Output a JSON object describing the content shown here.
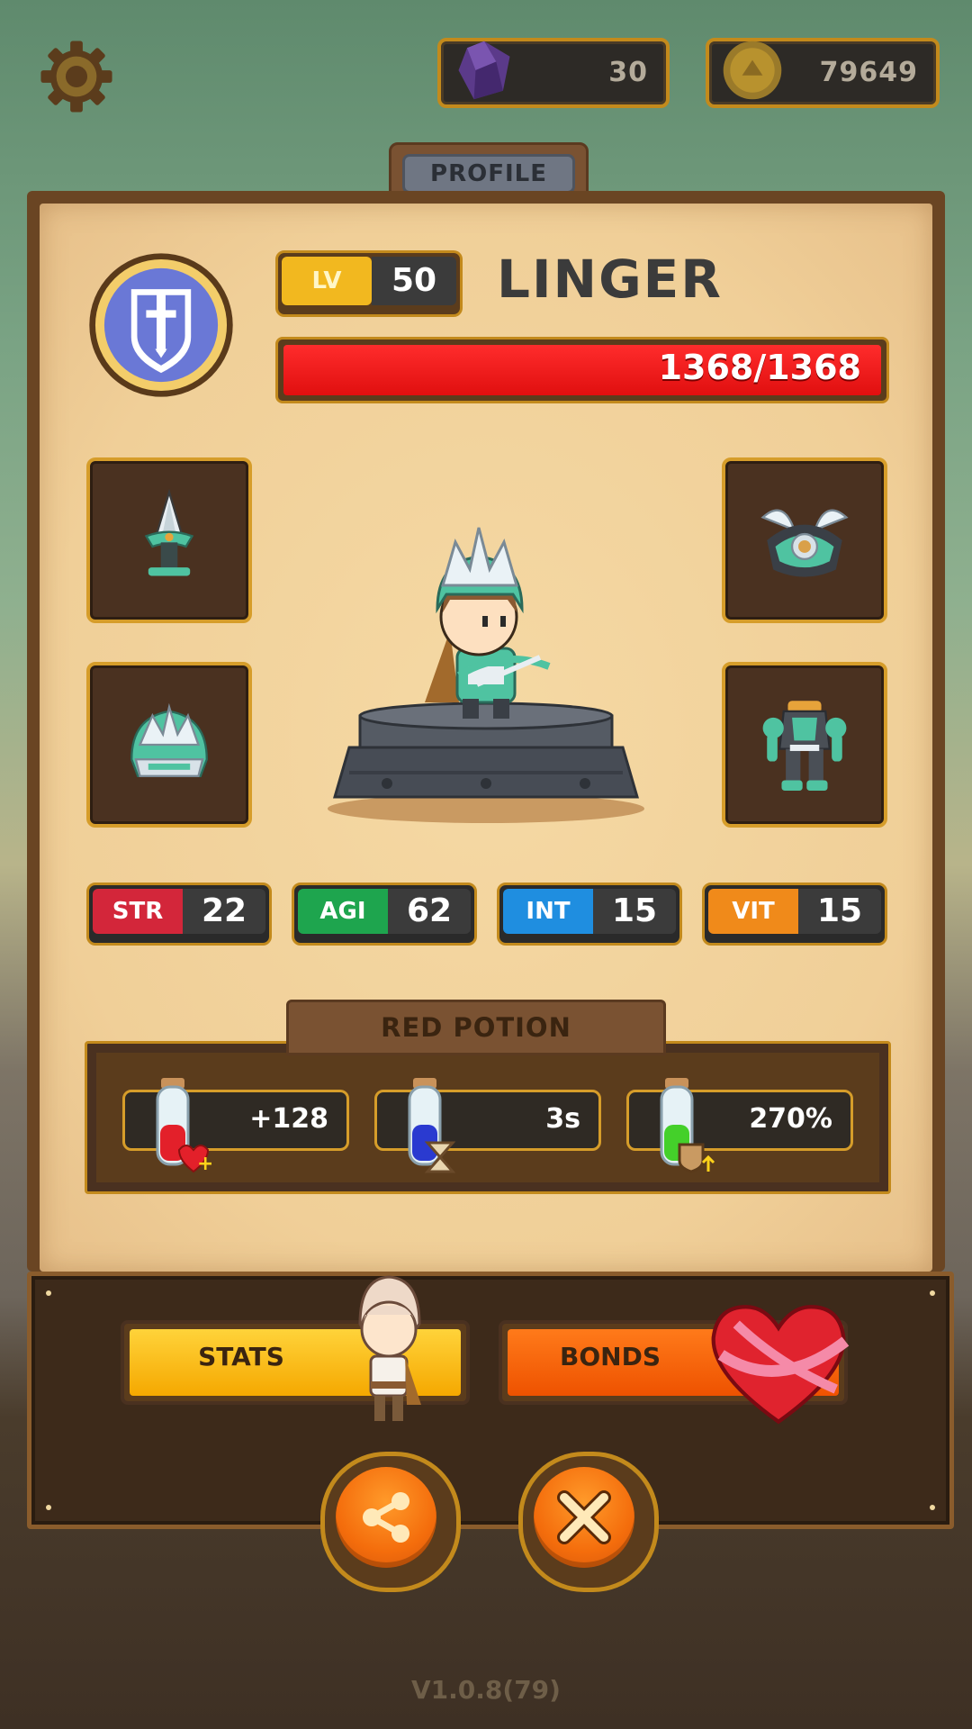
{
  "header": {
    "gems": "30",
    "coins": "79649"
  },
  "tab": {
    "label": "PROFILE"
  },
  "character": {
    "level_label": "LV",
    "level": "50",
    "name": "LINGER",
    "hp_text": "1368/1368",
    "hp_fraction": 1.0
  },
  "equipment_icons": [
    "dagger-icon",
    "shoulder-armor-icon",
    "helmet-icon",
    "body-armor-icon"
  ],
  "stats": [
    {
      "label": "STR",
      "value": "22",
      "color": "#d3263a"
    },
    {
      "label": "AGI",
      "value": "62",
      "color": "#1ea54e"
    },
    {
      "label": "INT",
      "value": "15",
      "color": "#1f8ee0"
    },
    {
      "label": "VIT",
      "value": "15",
      "color": "#f08a1a"
    }
  ],
  "potion": {
    "title": "RED POTION",
    "heal": "+128",
    "duration": "3s",
    "bonus": "270%"
  },
  "buttons": {
    "stats": "STATS",
    "bonds": "BONDS"
  },
  "version": "V1.0.8(79)"
}
